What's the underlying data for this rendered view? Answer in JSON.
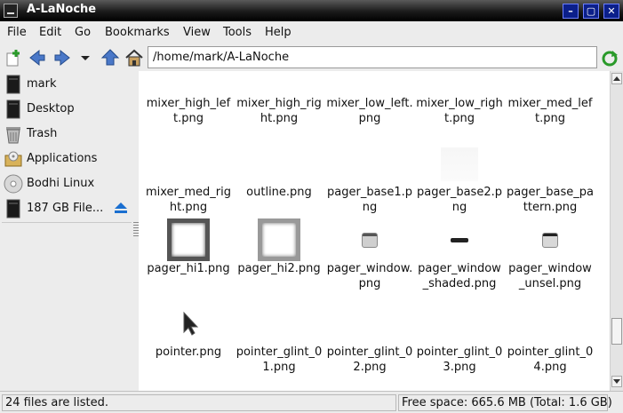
{
  "window": {
    "title": "A-LaNoche",
    "minimize": "–",
    "maximize": "▢",
    "close": "✕"
  },
  "menubar": {
    "items": [
      "File",
      "Edit",
      "Go",
      "Bookmarks",
      "View",
      "Tools",
      "Help"
    ]
  },
  "toolbar": {
    "path": "/home/mark/A-LaNoche"
  },
  "sidebar": {
    "items": [
      {
        "label": "mark",
        "icon": "drive-icon"
      },
      {
        "label": "Desktop",
        "icon": "drive-icon"
      },
      {
        "label": "Trash",
        "icon": "trash-icon"
      },
      {
        "label": "Applications",
        "icon": "applications-icon"
      },
      {
        "label": "Bodhi Linux",
        "icon": "disc-icon"
      },
      {
        "label": "187 GB File...",
        "icon": "drive-icon"
      }
    ]
  },
  "files": [
    {
      "name": "mixer_high_left.png"
    },
    {
      "name": "mixer_high_right.png"
    },
    {
      "name": "mixer_low_left.png"
    },
    {
      "name": "mixer_low_right.png"
    },
    {
      "name": "mixer_med_left.png"
    },
    {
      "name": "mixer_med_right.png"
    },
    {
      "name": "outline.png"
    },
    {
      "name": "pager_base1.png"
    },
    {
      "name": "pager_base2.png"
    },
    {
      "name": "pager_base_pattern.png"
    },
    {
      "name": "pager_hi1.png"
    },
    {
      "name": "pager_hi2.png"
    },
    {
      "name": "pager_window.png"
    },
    {
      "name": "pager_window_shaded.png"
    },
    {
      "name": "pager_window_unsel.png"
    },
    {
      "name": "pointer.png"
    },
    {
      "name": "pointer_glint_01.png"
    },
    {
      "name": "pointer_glint_02.png"
    },
    {
      "name": "pointer_glint_03.png"
    },
    {
      "name": "pointer_glint_04.png"
    }
  ],
  "status": {
    "count": "24 files are listed.",
    "space": "Free space: 665.6 MB (Total: 1.6 GB)"
  },
  "colors": {
    "title_bg": "#000000",
    "win_button": "#0b1f8a",
    "file_area": "#ffffff"
  }
}
